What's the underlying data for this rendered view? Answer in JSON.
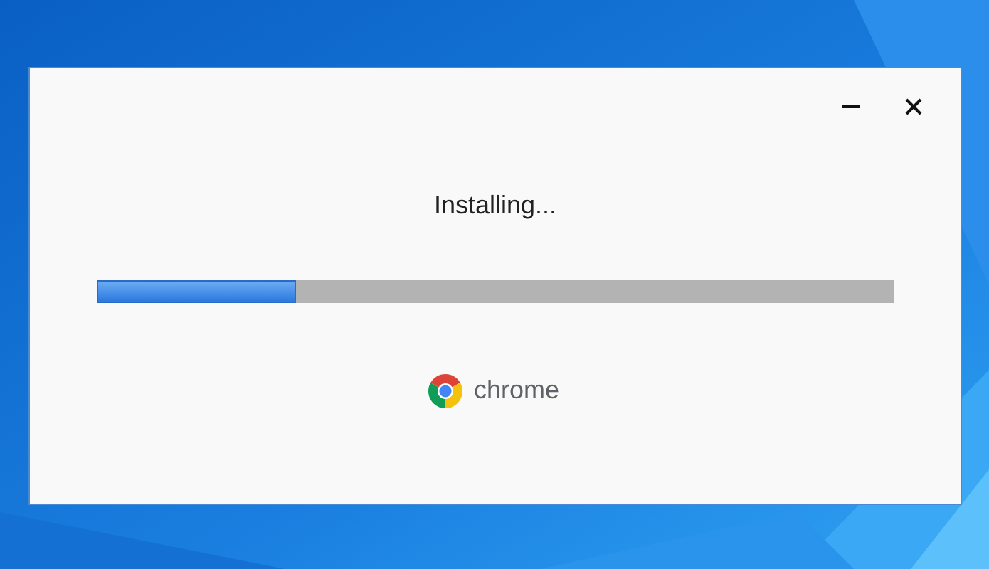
{
  "window": {
    "status": "Installing...",
    "progress": {
      "level": 0.25
    },
    "brand": "chrome"
  }
}
